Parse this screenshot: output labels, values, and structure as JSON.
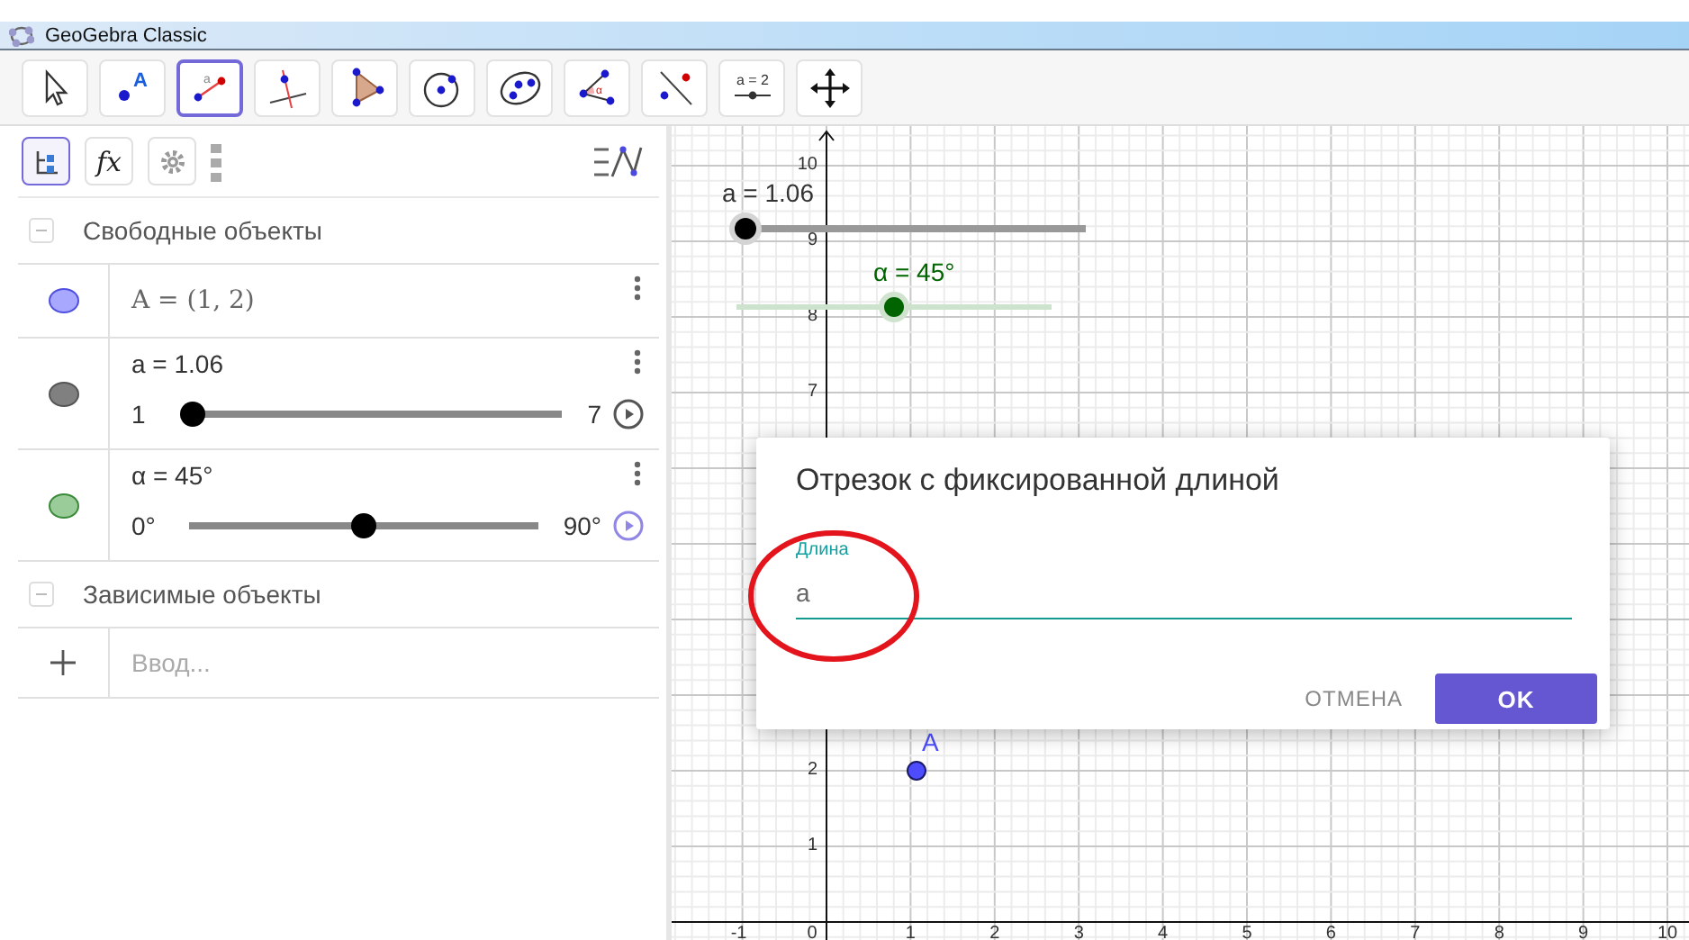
{
  "window": {
    "title": "GeoGebra Classic"
  },
  "toolbar": {
    "tools": [
      {
        "kind": "move",
        "selected": false
      },
      {
        "kind": "point",
        "label": "A",
        "selected": false
      },
      {
        "kind": "segment",
        "label": "a",
        "selected": true
      },
      {
        "kind": "perpendicular",
        "selected": false
      },
      {
        "kind": "polygon",
        "selected": false
      },
      {
        "kind": "circle",
        "selected": false
      },
      {
        "kind": "ellipse",
        "selected": false
      },
      {
        "kind": "angle",
        "label": "α",
        "selected": false
      },
      {
        "kind": "reflect",
        "selected": false
      },
      {
        "kind": "slider",
        "label": "a = 2",
        "selected": false
      },
      {
        "kind": "move-view",
        "selected": false
      }
    ]
  },
  "algebra_panel": {
    "tabs": [
      {
        "kind": "algebra",
        "selected": true
      },
      {
        "kind": "function",
        "label": "fx",
        "selected": false
      },
      {
        "kind": "settings",
        "selected": false
      }
    ],
    "sections": [
      {
        "title": "Свободные объекты",
        "expanded": true,
        "items": [
          {
            "kind": "point",
            "color": "#a8a8ff",
            "text": "A = (1, 2)"
          },
          {
            "kind": "slider",
            "color": "#808080",
            "text": "a = 1.06",
            "min": "1",
            "max": "7",
            "level": 0.01,
            "play_highlighted": false
          },
          {
            "kind": "slider",
            "color": "#99cc99",
            "text": "α = 45°",
            "min": "0°",
            "max": "90°",
            "level": 0.5,
            "play_highlighted": true
          }
        ]
      },
      {
        "title": "Зависимые объекты",
        "expanded": true
      }
    ],
    "input": {
      "placeholder": "Ввод..."
    }
  },
  "graphics": {
    "x_axis_labels": [
      "-1",
      "0",
      "1",
      "2",
      "3",
      "4",
      "5",
      "6",
      "7",
      "8",
      "9",
      "10"
    ],
    "y_axis_labels": [
      "10",
      "9",
      "8",
      "7",
      "2",
      "1"
    ],
    "sliders": [
      {
        "label": "a = 1.06",
        "color": "#000000",
        "level": 0.01
      },
      {
        "label": "α = 45°",
        "color": "#006400",
        "level": 0.5
      }
    ],
    "points": [
      {
        "label": "A"
      }
    ]
  },
  "dialog": {
    "title": "Отрезок с фиксированной длиной",
    "field": {
      "label": "Длина",
      "value": "a"
    },
    "buttons": [
      {
        "kind": "text",
        "label": "ОТМЕНА"
      },
      {
        "kind": "primary",
        "label": "OK"
      }
    ]
  },
  "annotation": {
    "kind": "ellipse"
  }
}
